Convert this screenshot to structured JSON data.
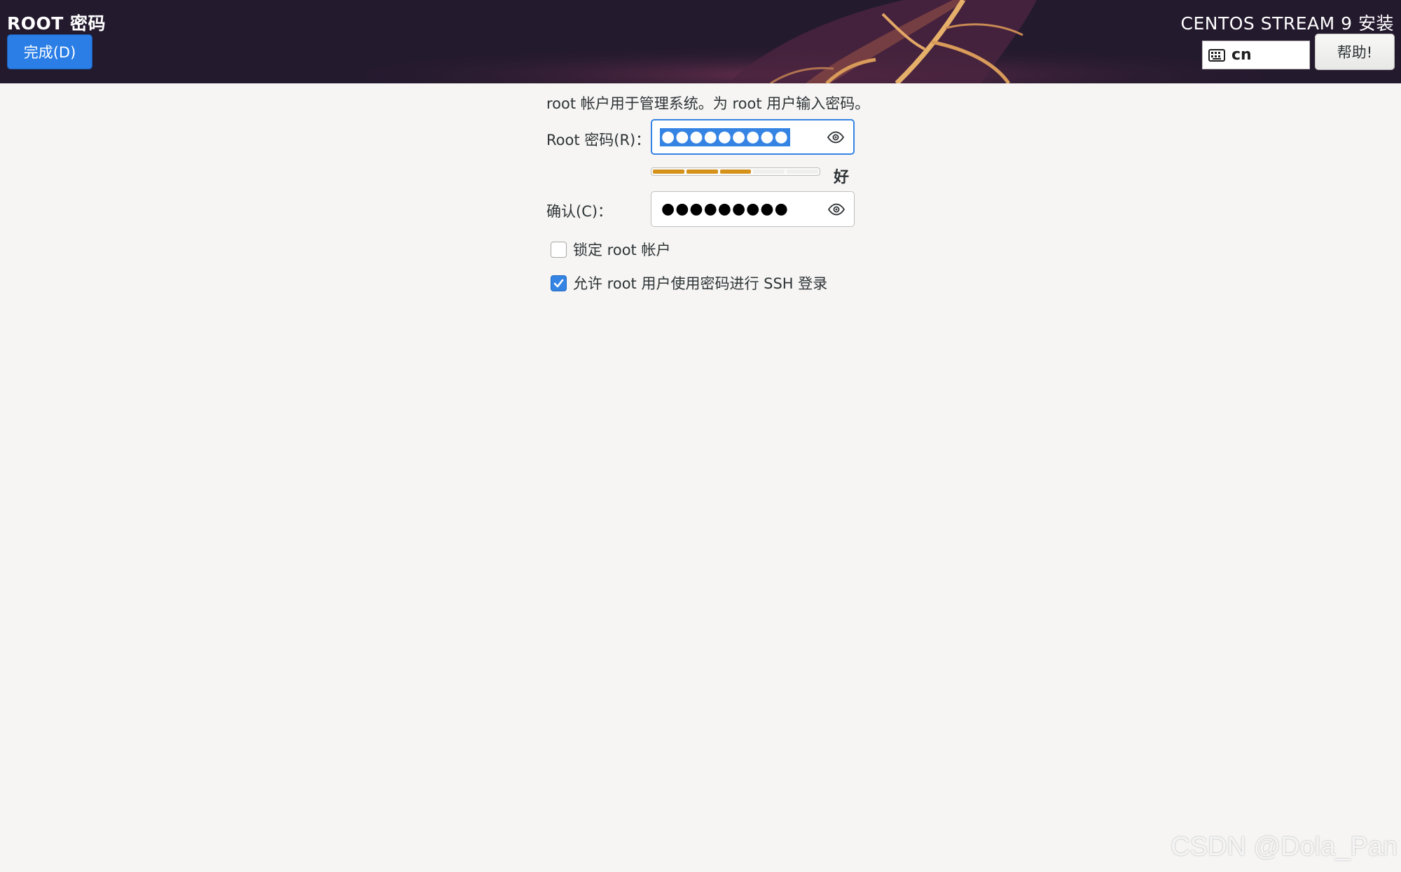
{
  "header": {
    "page_title": "ROOT 密码",
    "done_label": "完成(D)",
    "product_title": "CENTOS STREAM 9 安装",
    "keyboard_layout": "cn",
    "help_label": "帮助!"
  },
  "form": {
    "intro": "root 帐户用于管理系统。为 root 用户输入密码。",
    "root_password_label": "Root 密码(R)：",
    "root_password_mask": "●●●●●●●●●",
    "strength_label": "好",
    "strength_level": 0.6,
    "confirm_label": "确认(C)：",
    "confirm_password_mask": "●●●●●●●●●",
    "lock_root_label": "锁定 root 帐户",
    "lock_root_checked": false,
    "allow_ssh_label": "允许 root 用户使用密码进行 SSH 登录",
    "allow_ssh_checked": true
  },
  "watermark": "CSDN @Dola_Pan",
  "colors": {
    "accent": "#3584e4",
    "done_button": "#2a7ee6",
    "strength_fill": "#d4921b",
    "header_bg": "#261a30"
  },
  "icons": {
    "keyboard": "keyboard-icon",
    "reveal_password": "eye-icon",
    "checkmark": "check-icon"
  }
}
